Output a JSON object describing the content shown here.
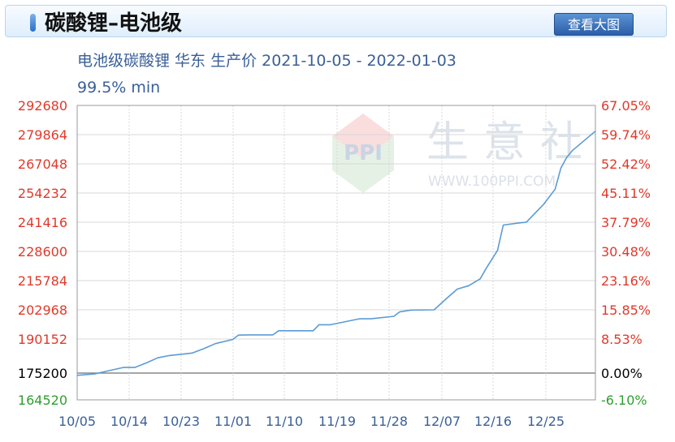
{
  "header": {
    "title": "碳酸锂–电池级",
    "view_large_label": "查看大图"
  },
  "chart_data": {
    "type": "line",
    "title": "电池级碳酸锂 华东 生产价 2021-10-05 - 2022-01-03",
    "subtitle": "99.5% min",
    "watermark": {
      "brand": "PPI",
      "cn": "生意社",
      "url": "WWW.100PPI.COM"
    },
    "x_tick_labels": [
      "10/05",
      "10/14",
      "10/23",
      "11/01",
      "11/10",
      "11/19",
      "11/28",
      "12/07",
      "12/16",
      "12/25"
    ],
    "x_range": [
      "2021-10-05",
      "2022-01-03"
    ],
    "y_ticks_left": [
      "292680",
      "279864",
      "267048",
      "254232",
      "241416",
      "228600",
      "215784",
      "202968",
      "190152",
      "175200",
      "164520"
    ],
    "y_ticks_right": [
      "67.05%",
      "59.74%",
      "52.42%",
      "45.11%",
      "37.79%",
      "30.48%",
      "23.16%",
      "15.85%",
      "8.53%",
      "0.00%",
      "-6.10%"
    ],
    "baseline": 175200,
    "colors": {
      "line": "#5b9bd5",
      "left_axis": "#e0392b",
      "right_axis": "#e0392b",
      "baseline_label": "#000000",
      "min_label": "#2f9e2f",
      "grid": "#d8d8d8"
    },
    "series": [
      {
        "x": [
          "2021-10-05",
          "2021-10-08",
          "2021-10-10",
          "2021-10-13",
          "2021-10-15",
          "2021-10-17",
          "2021-10-19",
          "2021-10-21",
          "2021-10-25",
          "2021-10-27",
          "2021-10-29",
          "2021-11-01",
          "2021-11-02",
          "2021-11-04",
          "2021-11-08",
          "2021-11-09",
          "2021-11-11",
          "2021-11-15",
          "2021-11-16",
          "2021-11-18",
          "2021-11-23",
          "2021-11-25",
          "2021-11-29",
          "2021-11-30",
          "2021-12-02",
          "2021-12-06",
          "2021-12-08",
          "2021-12-10",
          "2021-12-12",
          "2021-12-14",
          "2021-12-15",
          "2021-12-17",
          "2021-12-18",
          "2021-12-21",
          "2021-12-22",
          "2021-12-25",
          "2021-12-27",
          "2021-12-28",
          "2021-12-29",
          "2021-12-30",
          "2022-01-03"
        ],
        "values": [
          175200,
          175800,
          176900,
          178600,
          178600,
          180600,
          182800,
          183800,
          184900,
          186800,
          189000,
          190800,
          192700,
          192800,
          192800,
          194600,
          194600,
          194600,
          197200,
          197200,
          199800,
          199800,
          200900,
          202800,
          203600,
          203700,
          208300,
          212700,
          214200,
          217200,
          221600,
          229600,
          240600,
          241600,
          241800,
          249600,
          256200,
          265400,
          270000,
          273000,
          281500
        ]
      }
    ]
  }
}
